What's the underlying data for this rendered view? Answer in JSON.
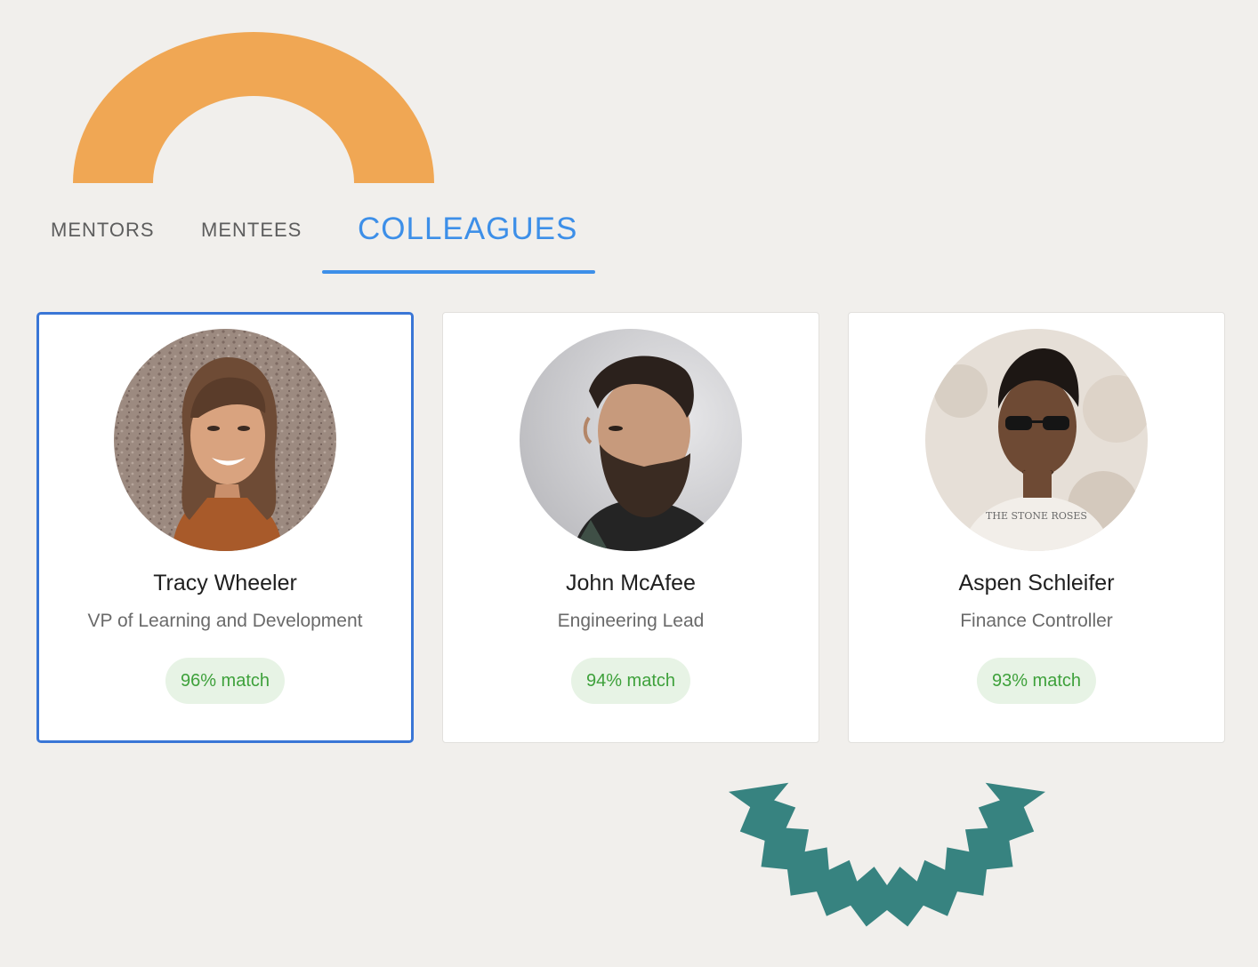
{
  "colors": {
    "background": "#f1efec",
    "accent": "#3d8fe8",
    "selected_border": "#3a76d6",
    "match_text": "#3ea13b",
    "match_background": "#e7f3e5",
    "arch_decoration": "#f0a754",
    "zigzag_decoration": "#378380"
  },
  "tabs": {
    "mentors_label": "MENTORS",
    "mentees_label": "MENTEES",
    "colleagues_label": "COLLEAGUES",
    "active": "COLLEAGUES"
  },
  "colleagues": [
    {
      "name": "Tracy Wheeler",
      "role": "VP of Learning and Development",
      "match": "96% match",
      "selected": true,
      "avatar_icon": "woman-smiling-photo"
    },
    {
      "name": "John McAfee",
      "role": "Engineering Lead",
      "match": "94% match",
      "selected": false,
      "avatar_icon": "bearded-man-profile-photo"
    },
    {
      "name": "Aspen Schleifer",
      "role": "Finance Controller",
      "match": "93% match",
      "selected": false,
      "avatar_icon": "man-with-sunglasses-photo",
      "shirt_text": "THE STONE ROSES"
    }
  ]
}
